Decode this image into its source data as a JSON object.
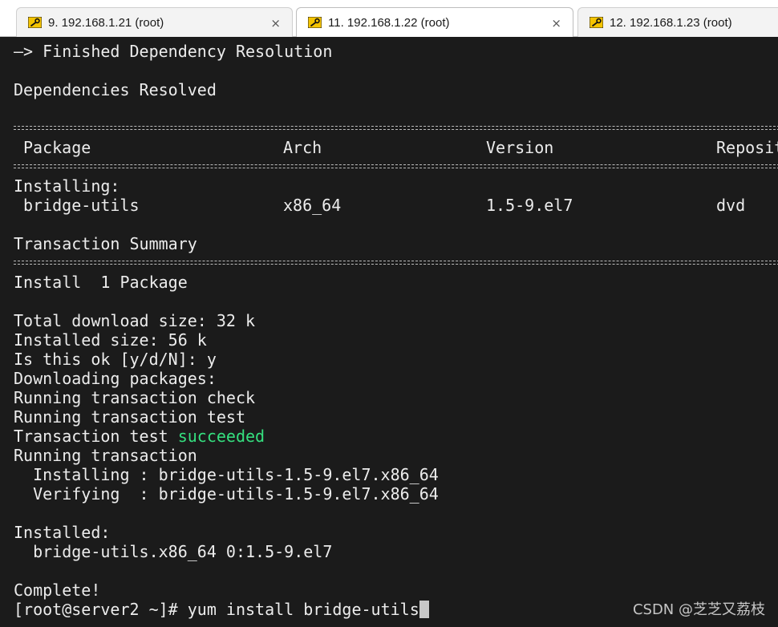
{
  "tabs": [
    {
      "label": "9. 192.168.1.21 (root)",
      "icon": "key-icon",
      "close": "×"
    },
    {
      "label": "11. 192.168.1.22 (root)",
      "icon": "key-icon",
      "close": "×",
      "active": true
    },
    {
      "label": "12. 192.168.1.23 (root)",
      "icon": "key-icon"
    }
  ],
  "terminal": {
    "finished": "—> Finished Dependency Resolution",
    "resolved": "Dependencies Resolved",
    "columns": {
      "package": "Package",
      "arch": "Arch",
      "version": "Version",
      "repository": "Reposit"
    },
    "installing_header": "Installing:",
    "package_row": {
      "package": "bridge-utils",
      "arch": "x86_64",
      "version": "1.5-9.el7",
      "repository": "dvd"
    },
    "transaction_summary": "Transaction Summary",
    "install_count": "Install  1 Package",
    "total_download": "Total download size: 32 k",
    "installed_size": "Installed size: 56 k",
    "prompt_ok": "Is this ok [y/d/N]: y",
    "downloading": "Downloading packages:",
    "running_check": "Running transaction check",
    "running_test": "Running transaction test",
    "test_prefix": "Transaction test ",
    "test_result": "succeeded",
    "running": "Running transaction",
    "installing_step": "  Installing : bridge-utils-1.5-9.el7.x86_64",
    "verifying_step": "  Verifying  : bridge-utils-1.5-9.el7.x86_64",
    "installed_header": "Installed:",
    "installed_pkg": "  bridge-utils.x86_64 0:1.5-9.el7",
    "complete": "Complete!",
    "prompt": "[root@server2 ~]# ",
    "command": "yum install bridge-utils"
  },
  "colors": {
    "background": "#1b1b1b",
    "text": "#ececec",
    "success": "#35e07f"
  },
  "watermark": "CSDN @芝芝又荔枝"
}
